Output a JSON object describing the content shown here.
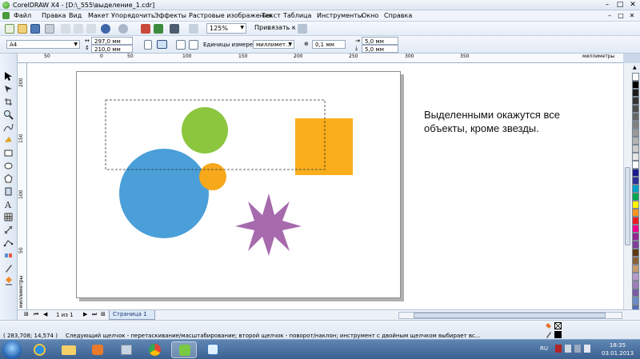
{
  "window": {
    "title": "CorelDRAW X4 - [D:\\_555\\выделение_1.cdr]",
    "minimize": "–",
    "maximize": "□",
    "close": "✕"
  },
  "menu": {
    "items": [
      {
        "label": "Файл"
      },
      {
        "label": "Правка"
      },
      {
        "label": "Вид"
      },
      {
        "label": "Макет"
      },
      {
        "label": "Упорядочить"
      },
      {
        "label": "Эффекты"
      },
      {
        "label": "Растровые изображения"
      },
      {
        "label": "Текст"
      },
      {
        "label": "Таблица"
      },
      {
        "label": "Инструменты"
      },
      {
        "label": "Окно"
      },
      {
        "label": "Справка"
      }
    ]
  },
  "toolbar": {
    "zoom": "125%",
    "snap_label": "Привязать к"
  },
  "propbar": {
    "paper_size": "A4",
    "width": "297,0 мм",
    "height": "210,0 мм",
    "units_label": "Единицы измерения:",
    "units_value": "миллимет...",
    "nudge": "0,1 мм",
    "dup_x": "5,0 мм",
    "dup_y": "5,0 мм"
  },
  "ruler": {
    "h_ticks": [
      "50",
      "0",
      "50",
      "100",
      "150",
      "200",
      "250",
      "300",
      "350"
    ],
    "h_unit": "миллиметры",
    "v_ticks": [
      "200",
      "150",
      "100",
      "50"
    ],
    "v_unit": "миллиметры"
  },
  "canvas": {
    "note": "Выделенными окажутся все объекты, кроме звезды.",
    "shapes": {
      "green": "#8cc63f",
      "blue": "#4a9fd8",
      "orange_small": "#f7a81b",
      "orange_square": "#fbae1c",
      "star": "#a66aad"
    }
  },
  "pagebar": {
    "page_count": "1 из 1",
    "page_tab": "Страница 1"
  },
  "status": {
    "coords": "( 283,708; 14,574 )",
    "hint": "Следующий щелчок - перетаскивание/масштабирование; второй щелчок - поворот/наклон; инструмент с двойным щелчком выбирает вс..."
  },
  "palette": {
    "colors": [
      "#ffffff",
      "#000000",
      "#1a1a1a",
      "#333333",
      "#4d4d4d",
      "#666666",
      "#808080",
      "#999999",
      "#b3b3b3",
      "#cccccc",
      "#e6e6e6",
      "#ffffff",
      "#1a1a8c",
      "#2e3192",
      "#00a0c6",
      "#00a651",
      "#fff200",
      "#f7941d",
      "#ed1c24",
      "#ec008c",
      "#92278f",
      "#7f3f98",
      "#603913",
      "#8c6239",
      "#c69c6d",
      "#b89bc9",
      "#9e7cb8",
      "#7a5aa6",
      "#6b8cc7",
      "#4f6fb0"
    ]
  },
  "taskbar": {
    "lang": "RU",
    "time": "18:35",
    "date": "03.01.2013"
  }
}
